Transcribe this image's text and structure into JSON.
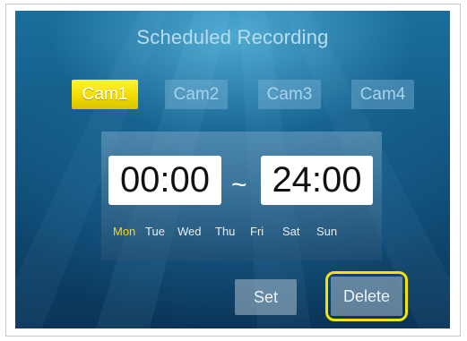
{
  "screen": {
    "title": "Scheduled Recording"
  },
  "cameras": [
    {
      "label": "Cam1",
      "selected": true
    },
    {
      "label": "Cam2",
      "selected": false
    },
    {
      "label": "Cam3",
      "selected": false
    },
    {
      "label": "Cam4",
      "selected": false
    }
  ],
  "schedule": {
    "start_time": "00:00",
    "separator": "~",
    "end_time": "24:00",
    "days": [
      {
        "label": "Mon",
        "selected": true
      },
      {
        "label": "Tue",
        "selected": false
      },
      {
        "label": "Wed",
        "selected": false
      },
      {
        "label": "Thu",
        "selected": false
      },
      {
        "label": "Fri",
        "selected": false
      },
      {
        "label": "Sat",
        "selected": false
      },
      {
        "label": "Sun",
        "selected": false
      }
    ]
  },
  "actions": {
    "set_label": "Set",
    "delete_label": "Delete",
    "focused": "delete"
  },
  "colors": {
    "selection_yellow": "#f2dc00",
    "background_blue": "#155f8a",
    "focus_ring": "#f4e400"
  }
}
